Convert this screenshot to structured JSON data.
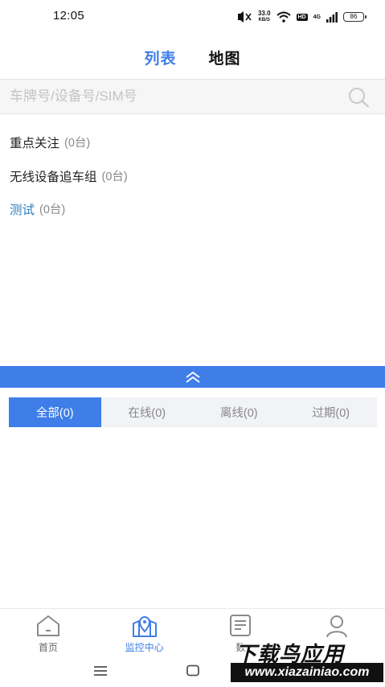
{
  "status_bar": {
    "time": "12:05",
    "speed_value": "33.0",
    "speed_unit": "KB/S",
    "hd": "HD",
    "network": "4G",
    "battery": "86"
  },
  "top_tabs": [
    {
      "label": "列表",
      "active": true
    },
    {
      "label": "地图",
      "active": false
    }
  ],
  "search": {
    "placeholder": "车牌号/设备号/SIM号",
    "value": ""
  },
  "groups": [
    {
      "name": "重点关注",
      "count": "(0台)"
    },
    {
      "name": "无线设备追车组",
      "count": "(0台)"
    },
    {
      "name": "测试",
      "count": "(0台)"
    }
  ],
  "filter_tabs": [
    {
      "label": "全部(0)",
      "active": true
    },
    {
      "label": "在线(0)",
      "active": false
    },
    {
      "label": "离线(0)",
      "active": false
    },
    {
      "label": "过期(0)",
      "active": false
    }
  ],
  "bottom_nav": [
    {
      "label": "首页",
      "icon": "home-icon",
      "active": false
    },
    {
      "label": "监控中心",
      "icon": "map-pin-icon",
      "active": true
    },
    {
      "label": "数",
      "icon": "document-icon",
      "active": false
    },
    {
      "label": "",
      "icon": "user-icon",
      "active": false
    }
  ],
  "watermark": {
    "title": "下载鸟应用",
    "url": "www.xiazainiao.com"
  },
  "colors": {
    "accent": "#3f7ee8",
    "group_highlight": "#2e7fc4",
    "muted_text": "#888888",
    "filter_bg": "#f2f3f7"
  }
}
